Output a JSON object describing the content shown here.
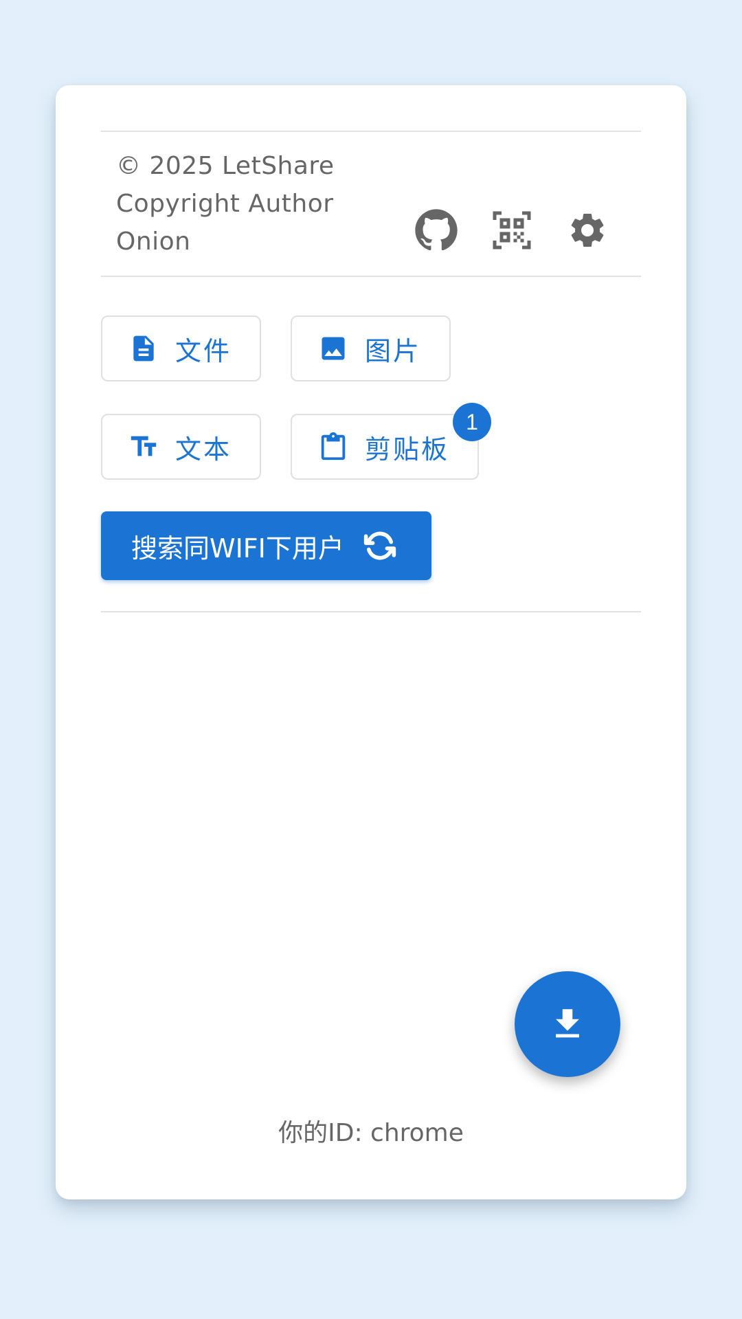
{
  "footer_info": {
    "copyright": "© 2025 LetShare\nCopyright Author\nOnion"
  },
  "header_icons": [
    {
      "name": "github-icon"
    },
    {
      "name": "qr-code-icon"
    },
    {
      "name": "gear-icon"
    }
  ],
  "actions": {
    "file_label": "文件",
    "image_label": "图片",
    "text_label": "文本",
    "clipboard_label": "剪贴板",
    "clipboard_badge": "1"
  },
  "search": {
    "label": "搜索同WIFI下用户"
  },
  "user": {
    "id_text": "你的ID: chrome"
  },
  "colors": {
    "accent": "#1b74d3",
    "background": "#e3f0fb",
    "icon_gray": "#666666"
  }
}
